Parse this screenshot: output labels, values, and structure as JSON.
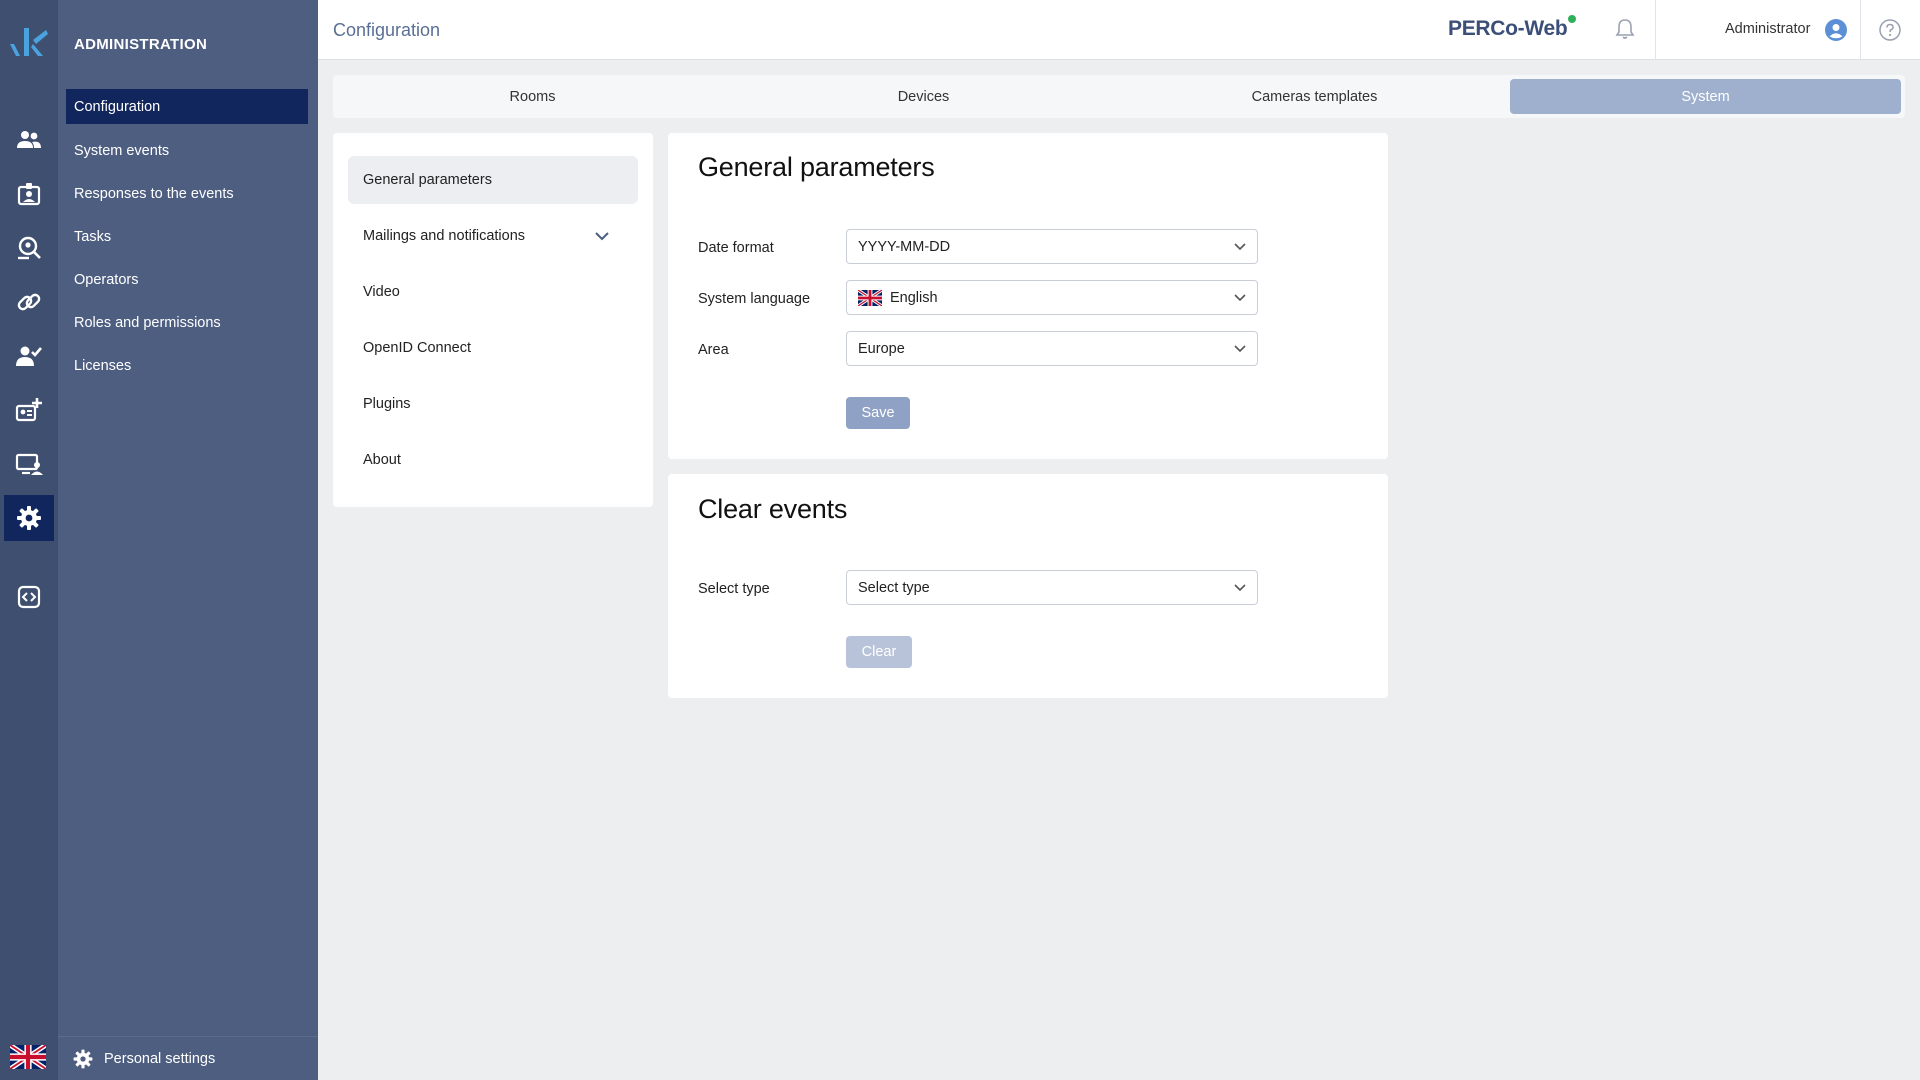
{
  "rail": {
    "icons": [
      "logo-icon",
      "people-icon",
      "badge-icon",
      "search-location-icon",
      "link-icon",
      "user-check-icon",
      "id-card-add-icon",
      "monitor-user-icon",
      "gear-icon",
      "code-icon",
      "uk-flag-icon"
    ],
    "active": "gear-icon"
  },
  "sidebar": {
    "heading": "ADMINISTRATION",
    "items": [
      {
        "label": "Configuration"
      },
      {
        "label": "System events"
      },
      {
        "label": "Responses to the events"
      },
      {
        "label": "Tasks"
      },
      {
        "label": "Operators"
      },
      {
        "label": "Roles and permissions"
      },
      {
        "label": "Licenses"
      }
    ],
    "personal_settings": "Personal settings"
  },
  "header": {
    "title": "Configuration",
    "brand": "PERCo-Web",
    "user": "Administrator"
  },
  "tabs": [
    {
      "label": "Rooms"
    },
    {
      "label": "Devices"
    },
    {
      "label": "Cameras templates"
    },
    {
      "label": "System"
    }
  ],
  "settings_menu": [
    {
      "label": "General parameters"
    },
    {
      "label": "Mailings and notifications"
    },
    {
      "label": "Video"
    },
    {
      "label": "OpenID Connect"
    },
    {
      "label": "Plugins"
    },
    {
      "label": "About"
    }
  ],
  "general": {
    "title": "General parameters",
    "date_format_label": "Date format",
    "date_format_value": "YYYY-MM-DD",
    "language_label": "System language",
    "language_value": "English",
    "area_label": "Area",
    "area_value": "Europe",
    "save": "Save"
  },
  "clear_events": {
    "title": "Clear events",
    "type_label": "Select type",
    "type_value": "Select type",
    "clear": "Clear"
  },
  "colors": {
    "rail_bg": "#3e4f70",
    "sidebar_bg": "#4e5e81",
    "active_bg": "#11265c",
    "tab_active": "#9fb0cf",
    "save_btn": "#8fa2c6",
    "clear_btn": "#b8c3d9"
  }
}
